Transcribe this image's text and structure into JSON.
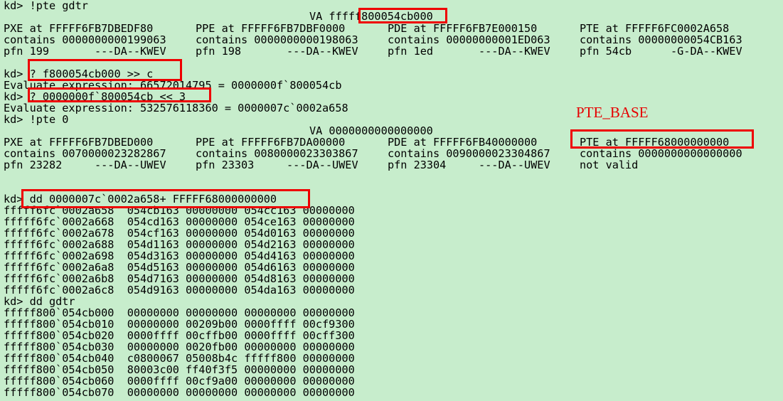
{
  "debugger": {
    "lines": {
      "l1": "kd> !pte gdtr",
      "l2": "VA fffff800054cb000",
      "l3": [
        "PXE at FFFFF6FB7DBEDF80",
        "PPE at FFFFF6FB7DBF0000",
        "PDE at FFFFF6FB7E000150",
        "PTE at FFFFF6FC0002A658"
      ],
      "l4": [
        "contains 0000000000199063",
        "contains 0000000000198063",
        "contains 00000000001ED063",
        "contains 00000000054CB163"
      ],
      "l5": [
        "pfn 199       ---DA--KWEV",
        "pfn 198       ---DA--KWEV",
        "pfn 1ed       ---DA--KWEV",
        "pfn 54cb      -G-DA--KWEV"
      ],
      "l6": "kd> ? f800054cb000 >> c",
      "l7": "Evaluate expression: 66572014795 = 0000000f`800054cb",
      "l8": "kd> ? 0000000f`800054cb << 3",
      "l9": "Evaluate expression: 532576118360 = 0000007c`0002a658",
      "l10": "kd> !pte 0",
      "l11": "VA 0000000000000000",
      "l12": [
        "PXE at FFFFF6FB7DBED000",
        "PPE at FFFFF6FB7DA00000",
        "PDE at FFFFF6FB40000000",
        "PTE at FFFFF68000000000"
      ],
      "l13": [
        "contains 0070000023282867",
        "contains 0080000023303867",
        "contains 0090000023304867",
        "contains 0000000000000000"
      ],
      "l14": [
        "pfn 23282     ---DA--UWEV",
        "pfn 23303     ---DA--UWEV",
        "pfn 23304     ---DA--UWEV",
        "not valid"
      ],
      "l15": "kd> dd 0000007c`0002a658+ FFFFF68000000000",
      "l16": "fffff6fc`0002a658  054cb163 00000000 054cc163 00000000",
      "l17": "fffff6fc`0002a668  054cd163 00000000 054ce163 00000000",
      "l18": "fffff6fc`0002a678  054cf163 00000000 054d0163 00000000",
      "l19": "fffff6fc`0002a688  054d1163 00000000 054d2163 00000000",
      "l20": "fffff6fc`0002a698  054d3163 00000000 054d4163 00000000",
      "l21": "fffff6fc`0002a6a8  054d5163 00000000 054d6163 00000000",
      "l22": "fffff6fc`0002a6b8  054d7163 00000000 054d8163 00000000",
      "l23": "fffff6fc`0002a6c8  054d9163 00000000 054da163 00000000",
      "l24": "kd> dd gdtr",
      "l25": "fffff800`054cb000  00000000 00000000 00000000 00000000",
      "l26": "fffff800`054cb010  00000000 00209b00 0000ffff 00cf9300",
      "l27": "fffff800`054cb020  0000ffff 00cffb00 0000ffff 00cff300",
      "l28": "fffff800`054cb030  00000000 0020fb00 00000000 00000000",
      "l29": "fffff800`054cb040  c0800067 05008b4c fffff800 00000000",
      "l30": "fffff800`054cb050  80003c00 ff40f3f5 00000000 00000000",
      "l31": "fffff800`054cb060  0000ffff 00cf9a00 00000000 00000000",
      "l32": "fffff800`054cb070  00000000 00000000 00000000 00000000"
    }
  },
  "annotation": {
    "label": "PTE_BASE",
    "color": "#e60000"
  },
  "colors": {
    "background": "#c7edcc",
    "highlight": "#ee0000"
  }
}
